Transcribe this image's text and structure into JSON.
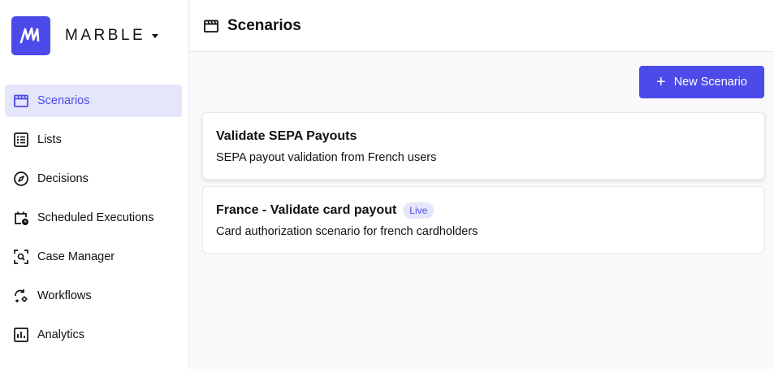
{
  "brand": {
    "name": "MARBLE"
  },
  "sidebar": {
    "items": [
      {
        "label": "Scenarios",
        "icon": "clapperboard-icon",
        "active": true
      },
      {
        "label": "Lists",
        "icon": "list-icon"
      },
      {
        "label": "Decisions",
        "icon": "compass-icon"
      },
      {
        "label": "Scheduled Executions",
        "icon": "calendar-clock-icon"
      },
      {
        "label": "Case Manager",
        "icon": "scan-search-icon"
      },
      {
        "label": "Workflows",
        "icon": "sync-gear-icon"
      },
      {
        "label": "Analytics",
        "icon": "bar-chart-icon"
      }
    ]
  },
  "header": {
    "title": "Scenarios",
    "icon": "clapperboard-icon"
  },
  "toolbar": {
    "new_label": "New Scenario"
  },
  "scenarios": [
    {
      "title": "Validate SEPA Payouts",
      "description": "SEPA payout validation from French users"
    },
    {
      "title": "France - Validate card payout",
      "badge": "Live",
      "description": "Card authorization scenario for french cardholders"
    }
  ],
  "colors": {
    "accent": "#4d4aea",
    "accent_light": "#e6e6fb",
    "background": "#f9f9fc"
  }
}
